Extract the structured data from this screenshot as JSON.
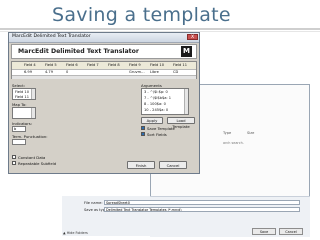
{
  "slide": {
    "title": "Saving a template"
  },
  "save_dialog": {
    "columns": [
      "Type",
      "Size"
    ],
    "hint": "arch search.",
    "file_name_label": "File name:",
    "file_name_value": "SpreadSheet0",
    "save_type_label": "Save as type:",
    "save_type_value": "Delimited Text Translator Templates (*.mrcd)",
    "save_label": "Save",
    "cancel_label": "Cancel",
    "hide_folders_label": "Hide Folders"
  },
  "window": {
    "title": "MarcEdit Delimited Text Translator",
    "close_label": "X",
    "header_title": "MarcEdit Delimited Text Translator",
    "logo_label": "M"
  },
  "grid": {
    "headers": [
      "Field 4",
      "Field 5",
      "Field 6",
      "Field 7",
      "Field 8",
      "Field 9",
      "Field 10",
      "Field 11"
    ],
    "row": [
      "6.99",
      "4.79",
      "0",
      "",
      "",
      "Gruvm...",
      "Libre",
      "CD"
    ]
  },
  "select": {
    "label": "Select:",
    "items": [
      "Field 10",
      "Field 11"
    ]
  },
  "map_to": {
    "label": "Map To:"
  },
  "arguments": {
    "label": "Arguments",
    "items": [
      "3 - ^\\$l:$p: 0",
      "7 - ^\\$l$b$a: 1",
      "8 - 100$a: 0",
      "10 - 245$a: 0"
    ]
  },
  "indicators": {
    "label": "Indicators:",
    "value": "b"
  },
  "term_punct": {
    "label": "Term. Punctuation:"
  },
  "buttons": {
    "apply": "Apply",
    "load_template": "Load Template",
    "finish": "Finish",
    "cancel": "Cancel"
  },
  "checks": {
    "save_template": "Save Template",
    "sort_fields": "Sort Fields",
    "constant_data": "Constant Data",
    "repeatable_subfield": "Repeatable Subfield"
  },
  "colors": {
    "title": "#4a6f8c",
    "window_bg": "#d4d0c8",
    "check_accent": "#2d6db0"
  }
}
